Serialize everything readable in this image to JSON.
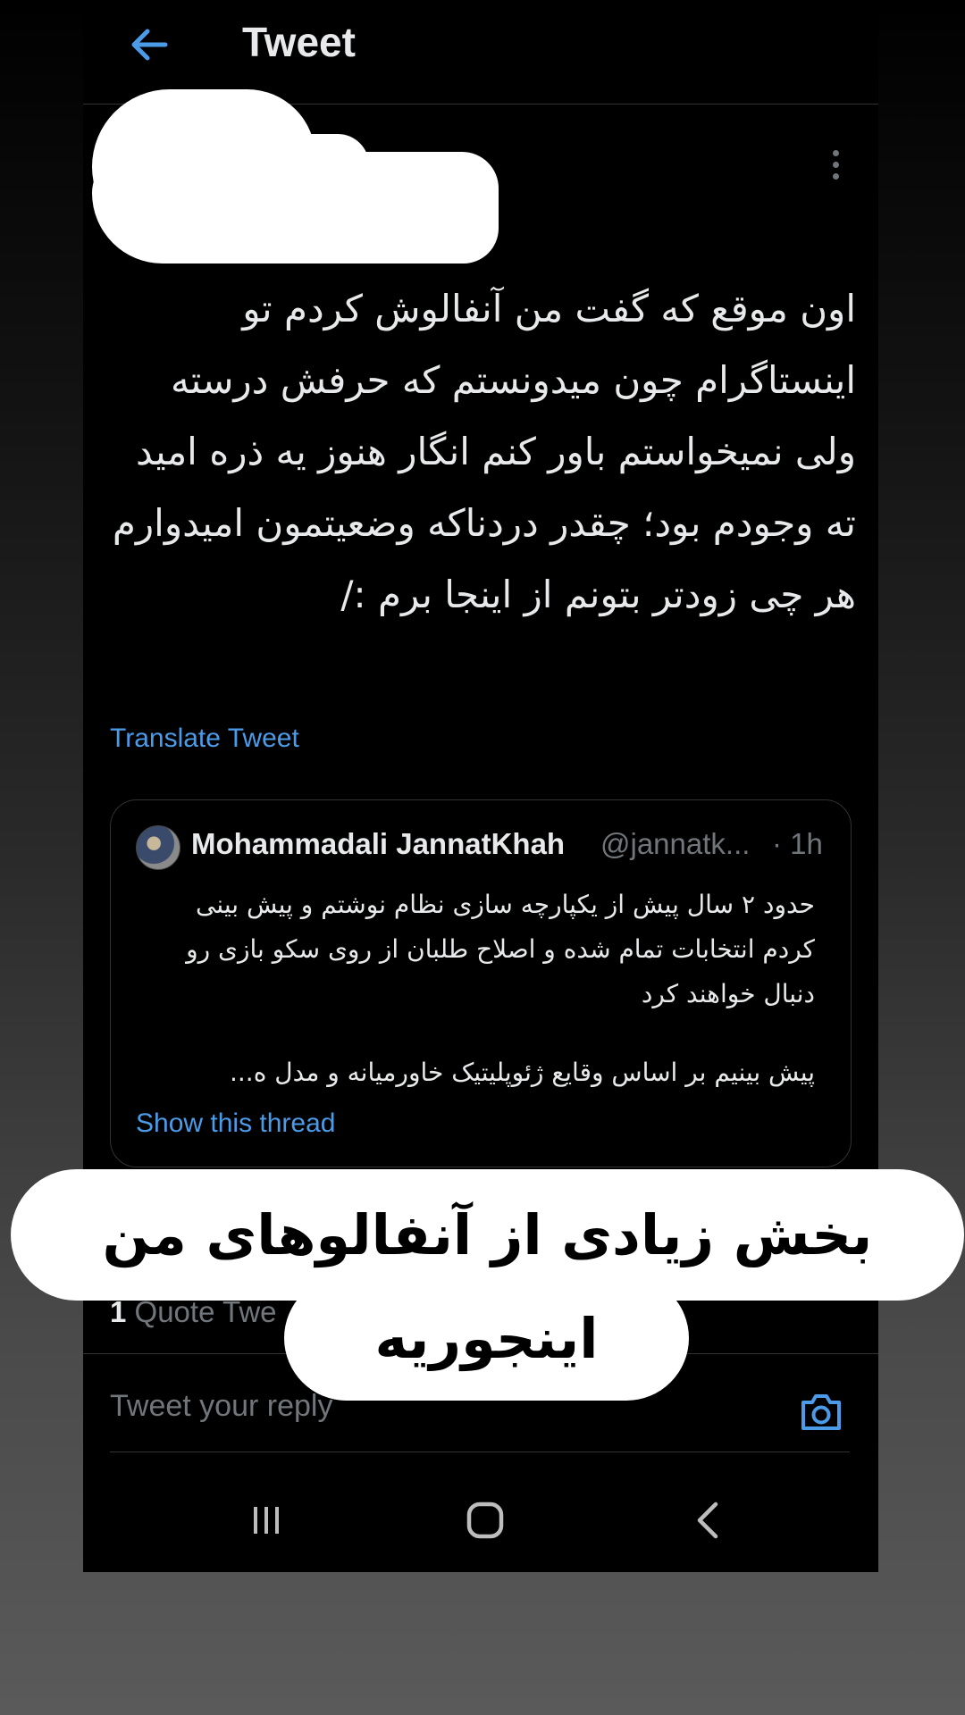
{
  "header": {
    "title": "Tweet"
  },
  "tweet": {
    "text": "اون موقع که گفت من آنفالوش کردم تو اینستاگرام چون میدونستم که حرفش درسته ولی نمیخواستم باور کنم انگار هنوز یه ذره امید ته وجودم بود؛ چقدر دردناکه وضعیتمون امیدوارم هر چی زودتر بتونم از اینجا برم :/",
    "translate_label": "Translate Tweet"
  },
  "quoted": {
    "name": "Mohammadali JannatKhah",
    "handle": "@jannatk...",
    "time": "· 1h",
    "text": "حدود ۲ سال پیش از یکپارچه سازی نظام نوشتم و پیش بینی کردم انتخابات تمام شده و اصلاح طلبان از روی سکو بازی رو دنبال خواهند کرد",
    "text_more": "پیش بینیم بر اساس وقایع ژئوپلیتیک خاورمیانه و مدل ه...",
    "thread_link": "Show this thread"
  },
  "stats": {
    "quote_count": "1",
    "quote_label": "Quote Twe"
  },
  "reply": {
    "placeholder": "Tweet your reply"
  },
  "caption": {
    "line1": "بخش زیادی از آنفالوهای من",
    "line2": "اینجوریه"
  },
  "colors": {
    "accent": "#4c9be8",
    "background": "#000000",
    "text": "#e7e9ea",
    "muted": "#71767b"
  },
  "icons": {
    "back": "arrow-left-icon",
    "more": "more-vertical-icon",
    "camera": "camera-icon",
    "nav_recent": "recent-apps-icon",
    "nav_home": "home-icon",
    "nav_back": "chevron-left-icon"
  }
}
